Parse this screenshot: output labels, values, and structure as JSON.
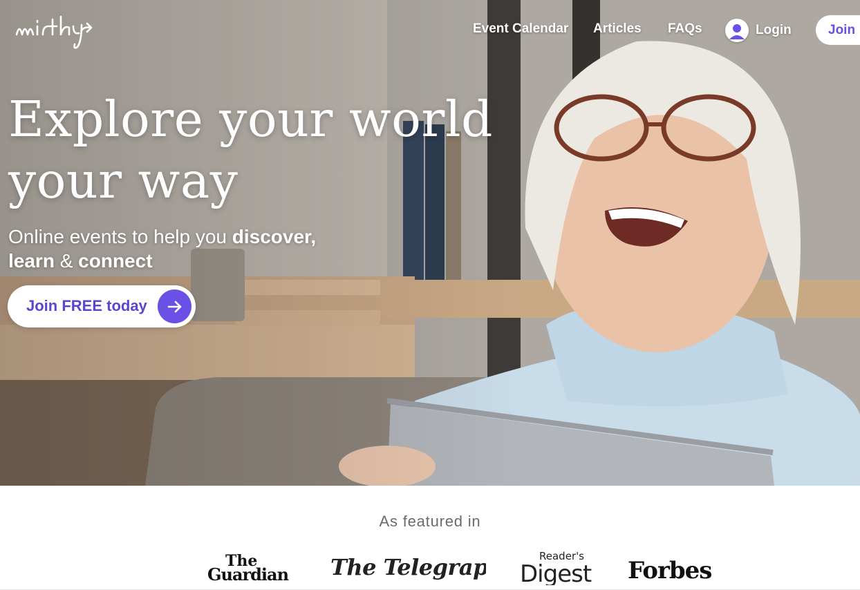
{
  "brand": {
    "name": "mirthy"
  },
  "nav": {
    "events": "Event Calendar",
    "articles": "Articles",
    "faqs": "FAQs",
    "login": "Login",
    "join": "Join"
  },
  "hero": {
    "headline_line1": "Explore your world",
    "headline_line2": "your way",
    "subline_prefix": "Online events to help you ",
    "subline_bold1": "discover,",
    "subline_bold2": "learn",
    "subline_amp": " & ",
    "subline_bold3": "connect",
    "cta_label": "Join FREE today",
    "cta_icon": "arrow-right-icon"
  },
  "featured": {
    "title": "As featured in",
    "logos": [
      "The Guardian",
      "The Telegraph",
      "Reader's Digest",
      "Forbes"
    ],
    "logo_guardian_line1": "The",
    "logo_guardian_line2": "Guardian",
    "logo_telegraph": "The Telegraph",
    "logo_digest_small": "Reader's",
    "logo_digest_main": "Digest",
    "logo_forbes": "Forbes"
  },
  "colors": {
    "accent": "#6b50e6",
    "accent_text": "#5b45cf",
    "white": "#ffffff",
    "muted_text": "#6b6b6b"
  }
}
